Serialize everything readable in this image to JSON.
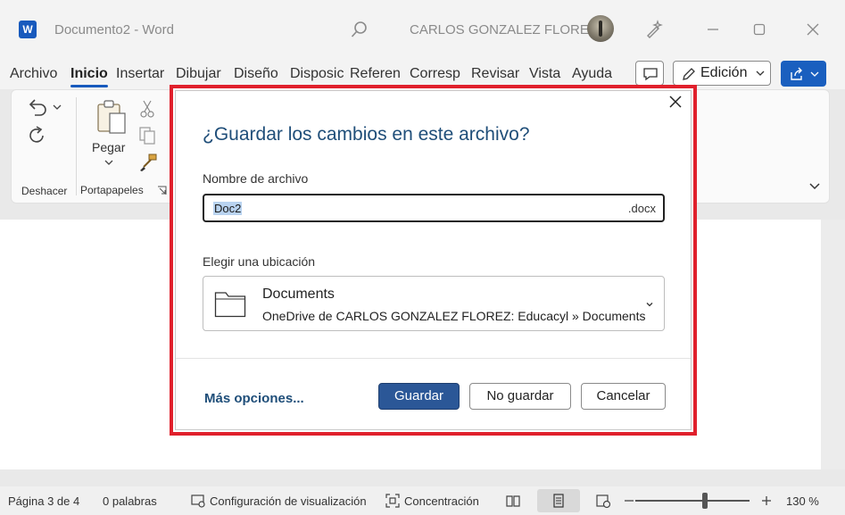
{
  "app": {
    "title": "Documento2 - Word",
    "logo_letter": "W",
    "user_name": "CARLOS GONZALEZ FLOREZ"
  },
  "menu": {
    "tabs": [
      "Archivo",
      "Inicio",
      "Insertar",
      "Dibujar",
      "Diseño",
      "Disposic",
      "Referen",
      "Corresp",
      "Revisar",
      "Vista",
      "Ayuda"
    ],
    "active_tab": "Inicio",
    "edit_mode_label": "Edición"
  },
  "ribbon": {
    "undo_group_label": "Deshacer",
    "paste_label": "Pegar",
    "clipboard_group_label": "Portapapeles"
  },
  "status": {
    "page": "Página 3 de 4",
    "words": "0 palabras",
    "display_settings": "Configuración de visualización",
    "focus": "Concentración",
    "zoom": "130 %"
  },
  "dialog": {
    "title": "¿Guardar los cambios en este archivo?",
    "filename_label": "Nombre de archivo",
    "filename_value": "Doc2",
    "filename_ext": ".docx",
    "location_label": "Elegir una ubicación",
    "location_name": "Documents",
    "location_path": "OneDrive de CARLOS GONZALEZ FLOREZ: Educacyl » Documents",
    "more_options": "Más opciones...",
    "save_button": "Guardar",
    "nosave_button": "No guardar",
    "cancel_button": "Cancelar"
  },
  "colors": {
    "accent": "#185abd",
    "dialog_highlight_border": "#e0202c",
    "primary_button": "#2b5797",
    "title_text": "#1f4e79"
  }
}
